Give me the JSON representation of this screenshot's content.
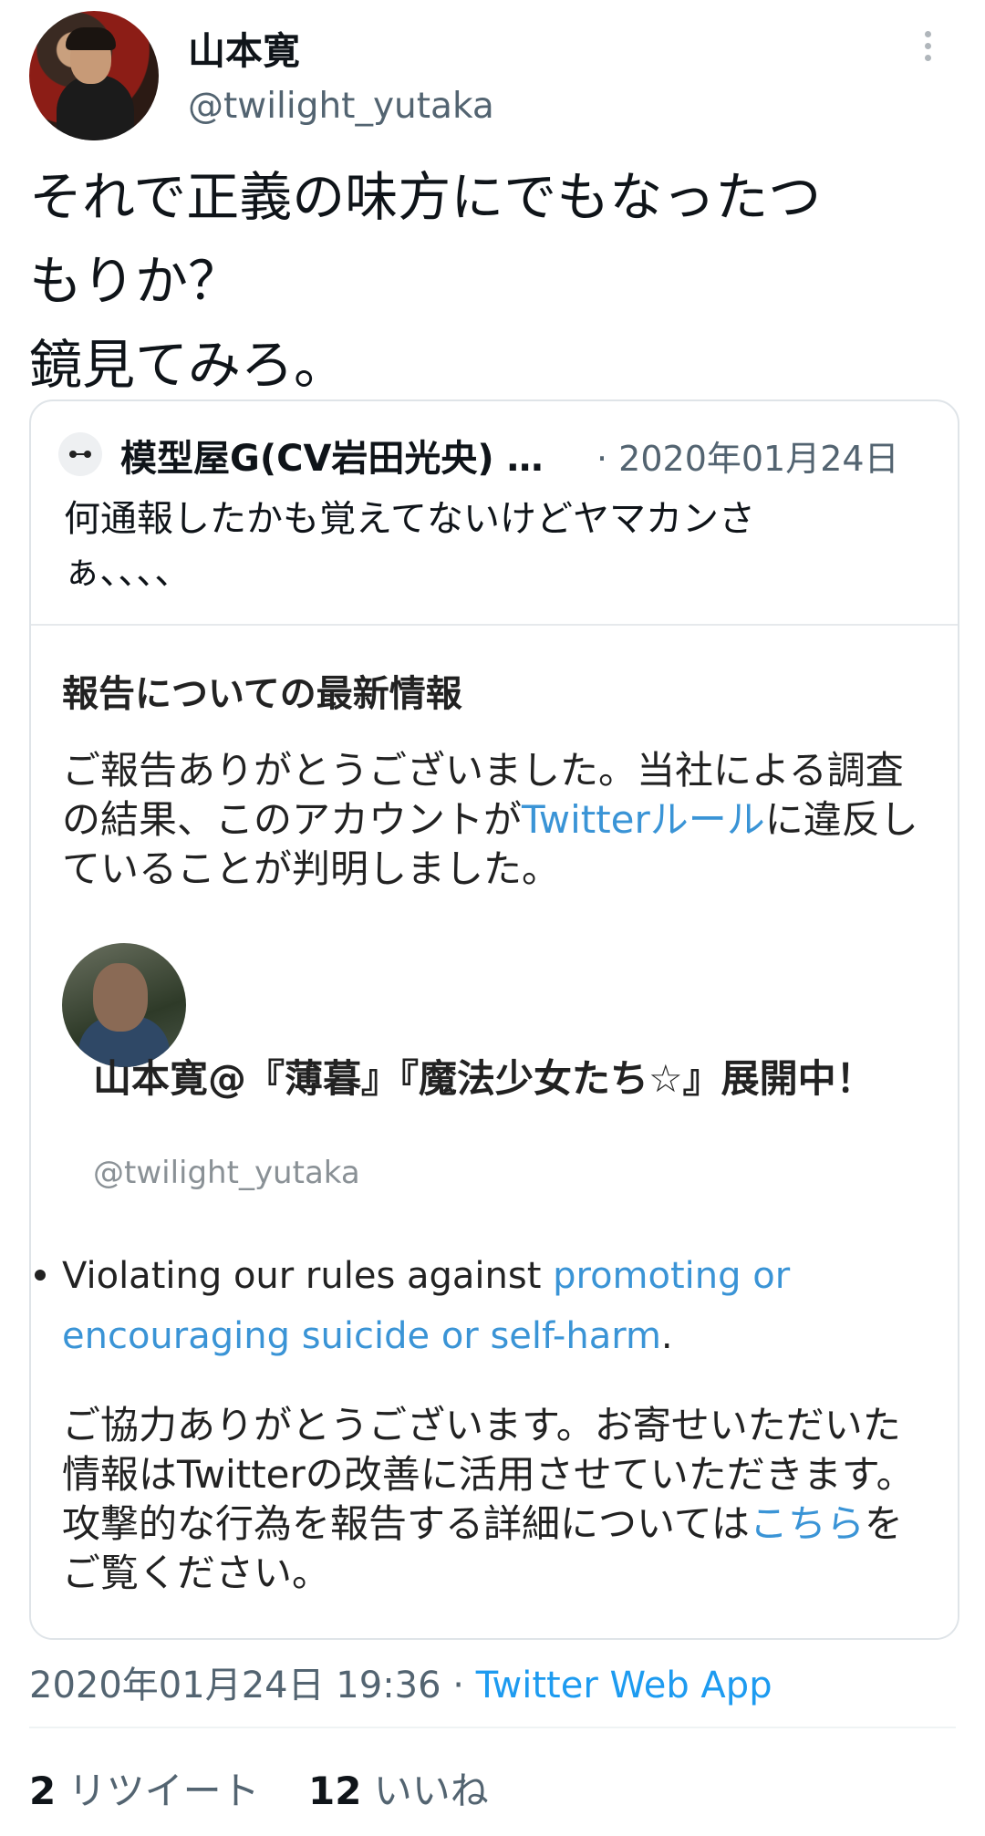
{
  "author": {
    "name": "山本寛",
    "handle": "@twilight_yutaka",
    "avatar_icon": "user-avatar-photo"
  },
  "tweet": {
    "text": "それで正義の味方にでもなったつ\nもりか？\n鏡見てみろ。"
  },
  "quote": {
    "name": "模型屋G(CV岩田光央) …",
    "date": "· 2020年01月24日",
    "text": "何通報したかも覚えてないけどヤマカンさ\nぁ、、、、",
    "report": {
      "title": "報告についての最新情報",
      "body_pre": "ご報告ありがとうございました。当社による調査の結果、このアカウントが",
      "body_link": "Twitterルール",
      "body_post": "に違反していることが判明しました。",
      "reported_name": "山本寛@『薄暮』『魔法少女たち☆』展開中！",
      "reported_handle": "@twilight_yutaka",
      "bullet_pre": "Violating our rules against ",
      "bullet_link": "promoting or encouraging suicide or self-harm",
      "bullet_post": ".",
      "thanks_pre": "ご協力ありがとうございます。お寄せいただいた情報はTwitterの改善に活用させていただきます。攻撃的な行為を報告する詳細については",
      "thanks_link": "こちら",
      "thanks_post": "をご覧ください。"
    }
  },
  "meta": {
    "timestamp": "2020年01月24日 19:36 · ",
    "app": "Twitter Web App"
  },
  "stats": {
    "retweets_count": "2",
    "retweets_label": " リツイート",
    "likes_count": "12",
    "likes_label": " いいね"
  },
  "colors": {
    "link": "#3a94d6",
    "accent": "#1d9bf0",
    "secondary": "#536471"
  }
}
